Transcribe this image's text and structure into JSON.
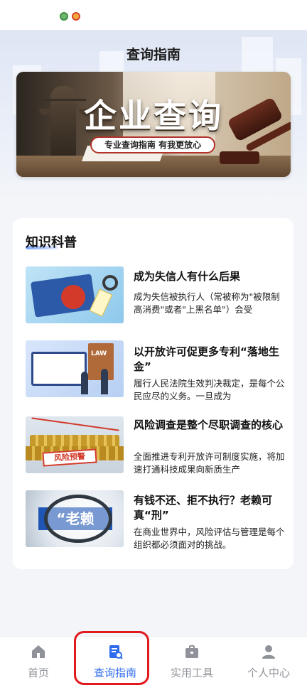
{
  "status_bar": {
    "icons": [
      "app-icon",
      "weibo-icon"
    ]
  },
  "header": {
    "title": "查询指南"
  },
  "banner": {
    "title": "企业查询",
    "slogan": "专业查询指南 有我更放心",
    "colors": {
      "slogan_border": "#b2332a"
    }
  },
  "knowledge": {
    "section_title": "知识科普",
    "articles": [
      {
        "title": "成为失信人有什么后果",
        "description": " 成为失信被执行人（常被称为\"被限制高消费\"或者\"上黑名单\"）会受",
        "thumb_icon": "blacklist-illustration"
      },
      {
        "title": "以开放许可促更多专利“落地生金”",
        "description": "履行人民法院生效判决裁定，是每个公民应尽的义务。一旦成为",
        "thumb_icon": "law-illustration",
        "thumb_text": "LAW"
      },
      {
        "title": "风险调查是整个尽职调查的核心",
        "description": "全面推进专利开放许可制度实施，将加速打通科技成果向新质生产",
        "thumb_icon": "risk-warning-illustration",
        "thumb_text": "风险预警"
      },
      {
        "title": "有钱不还、拒不执行？老赖可真“刑”",
        "description": "在商业世界中，风险评估与管理是每个组织都必须面对的挑战。",
        "thumb_icon": "magnifier-illustration",
        "thumb_text": "“老赖"
      }
    ]
  },
  "tabbar": {
    "tabs": [
      {
        "label": "首页",
        "icon": "home-icon",
        "active": false
      },
      {
        "label": "查询指南",
        "icon": "guide-doc-icon",
        "active": true
      },
      {
        "label": "实用工具",
        "icon": "toolbox-icon",
        "active": false
      },
      {
        "label": "个人中心",
        "icon": "person-icon",
        "active": false
      }
    ],
    "colors": {
      "active": "#2f6bed",
      "inactive": "#8f9399",
      "highlight": "#e0191d"
    }
  }
}
